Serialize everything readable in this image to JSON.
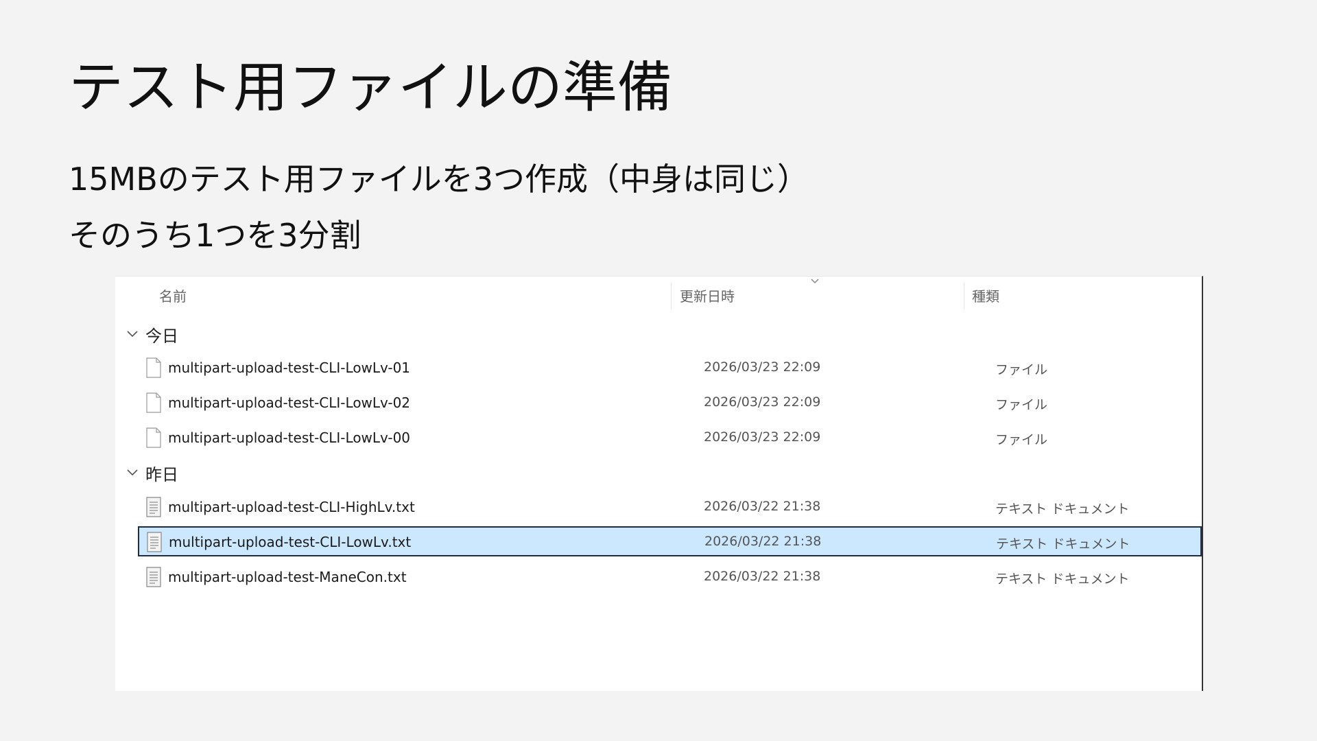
{
  "slide": {
    "title": "テスト用ファイルの準備",
    "bullets": [
      "15MBのテスト用ファイルを3つ作成（中身は同じ）",
      "そのうち1つを3分割"
    ]
  },
  "explorer": {
    "columns": {
      "name": "名前",
      "modified": "更新日時",
      "type": "種類"
    },
    "groups": [
      {
        "label": "今日",
        "files": [
          {
            "name": "multipart-upload-test-CLI-LowLv-01",
            "modified": "2026/03/23 22:09",
            "type": "ファイル",
            "icon": "file-icon",
            "selected": false
          },
          {
            "name": "multipart-upload-test-CLI-LowLv-02",
            "modified": "2026/03/23 22:09",
            "type": "ファイル",
            "icon": "file-icon",
            "selected": false
          },
          {
            "name": "multipart-upload-test-CLI-LowLv-00",
            "modified": "2026/03/23 22:09",
            "type": "ファイル",
            "icon": "file-icon",
            "selected": false
          }
        ]
      },
      {
        "label": "昨日",
        "files": [
          {
            "name": "multipart-upload-test-CLI-HighLv.txt",
            "modified": "2026/03/22 21:38",
            "type": "テキスト ドキュメント",
            "icon": "text-document-icon",
            "selected": false
          },
          {
            "name": "multipart-upload-test-CLI-LowLv.txt",
            "modified": "2026/03/22 21:38",
            "type": "テキスト ドキュメント",
            "icon": "text-document-icon",
            "selected": true
          },
          {
            "name": "multipart-upload-test-ManeCon.txt",
            "modified": "2026/03/22 21:38",
            "type": "テキスト ドキュメント",
            "icon": "text-document-icon",
            "selected": false
          }
        ]
      }
    ],
    "colors": {
      "selection_fill": "#cce8ff",
      "selection_border": "#1f2a44",
      "page_background": "#f3f3f3"
    }
  }
}
